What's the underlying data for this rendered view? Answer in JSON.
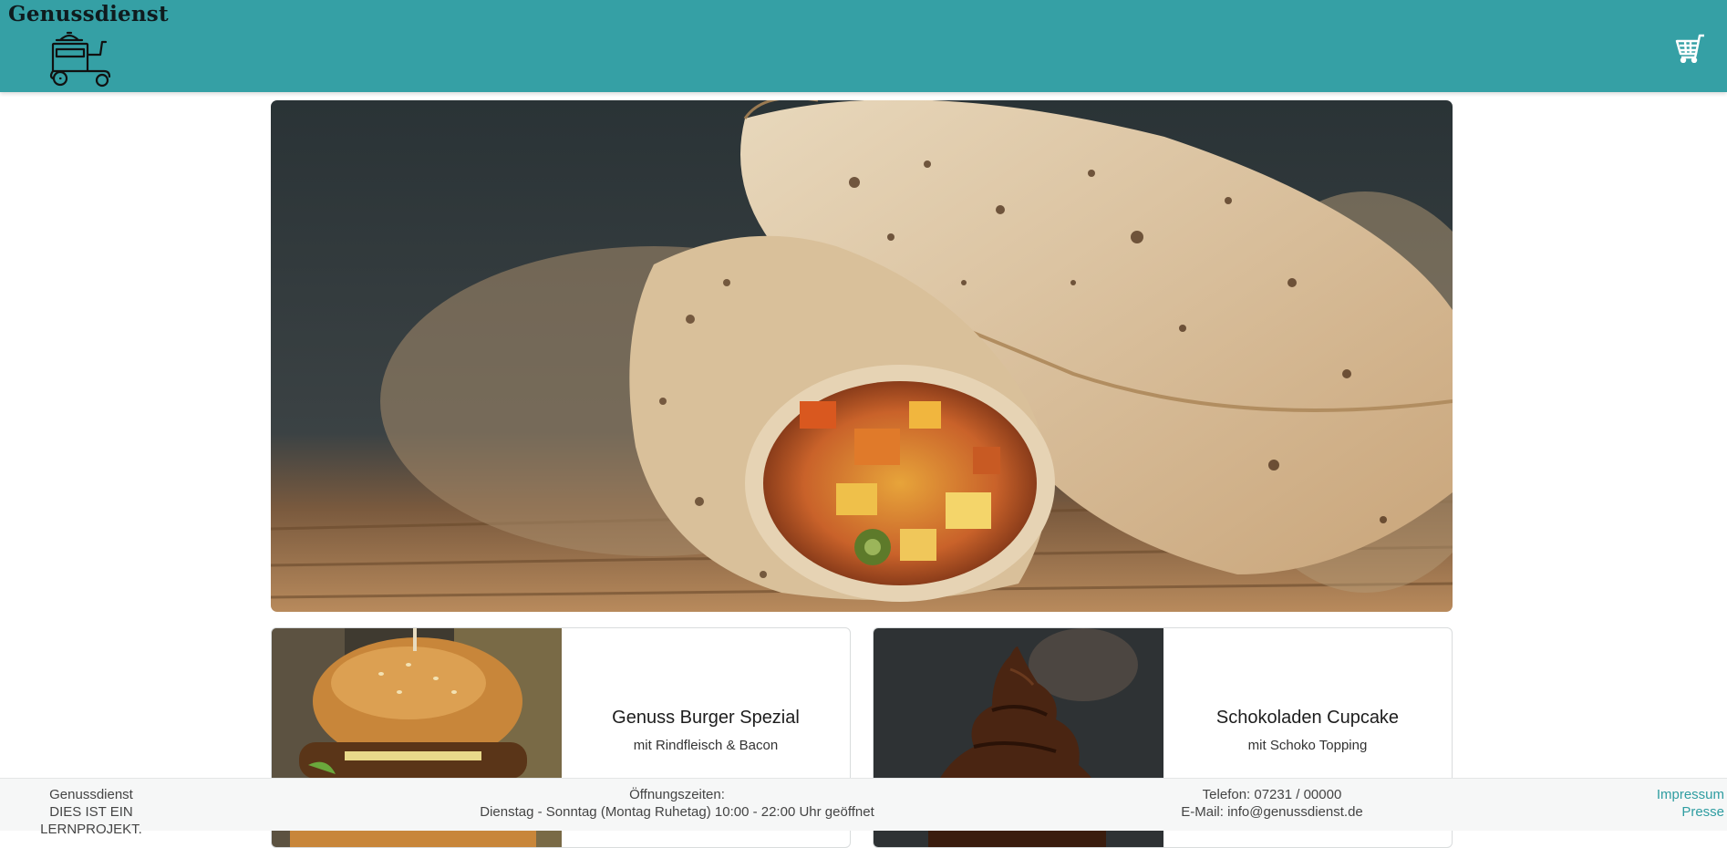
{
  "header": {
    "brand": "Genussdienst",
    "logo_icon": "food-scooter-icon",
    "cart_icon": "shopping-cart-icon",
    "background": "#35a0a5"
  },
  "hero": {
    "image": "food-wraps-photo"
  },
  "cards": [
    {
      "title": "Genuss Burger Spezial",
      "subtitle": "mit Rindfleisch & Bacon",
      "image": "burger-photo"
    },
    {
      "title": "Schokoladen Cupcake",
      "subtitle": "mit Schoko Topping",
      "image": "chocolate-cupcake-photo"
    }
  ],
  "footer": {
    "company": "Genussdienst",
    "notice": "DIES IST EIN LERNPROJEKT.",
    "hours_label": "Öffnungszeiten:",
    "hours": "Dienstag - Sonntag (Montag Ruhetag) 10:00 - 22:00 Uhr geöffnet",
    "phone": "Telefon: 07231 / 00000",
    "email": "E-Mail: info@genussdienst.de",
    "links": [
      "Impressum",
      "Presse"
    ],
    "link_color": "#2f9da1"
  }
}
